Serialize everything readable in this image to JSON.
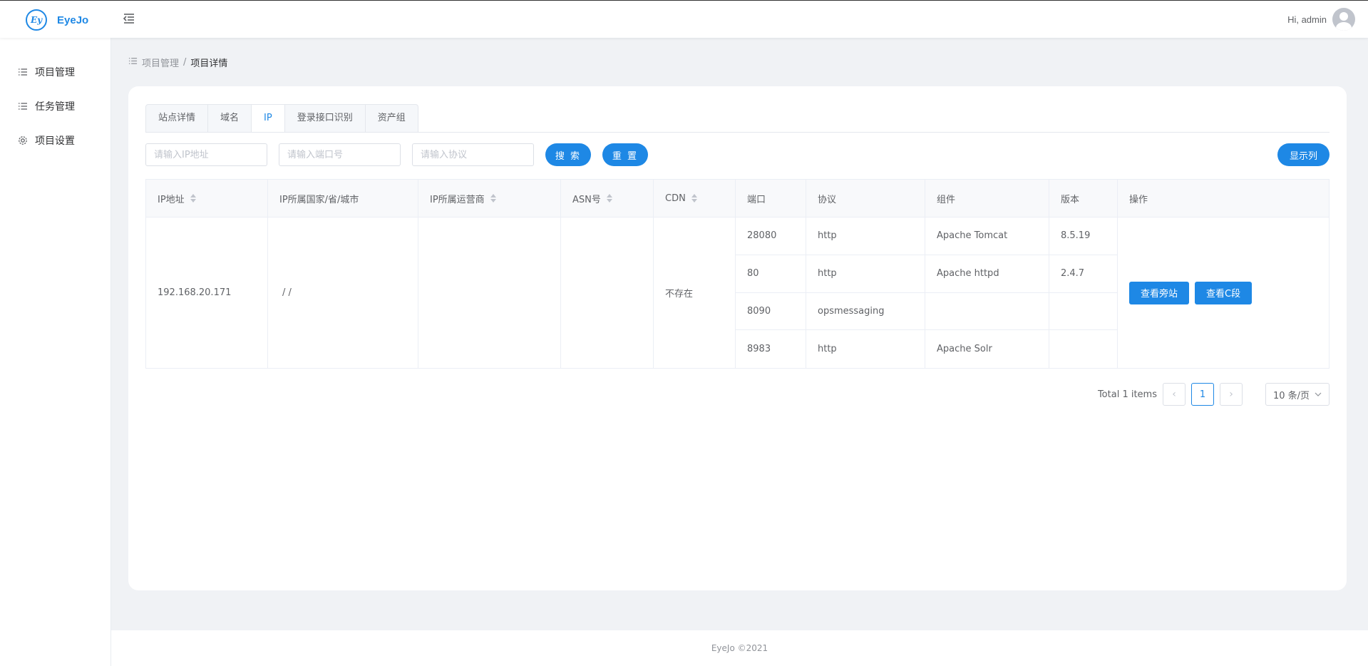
{
  "app": {
    "name": "EyeJo"
  },
  "header": {
    "greeting": "Hi, admin"
  },
  "sidebar": {
    "items": [
      {
        "label": "项目管理",
        "icon": "list-icon"
      },
      {
        "label": "任务管理",
        "icon": "list-icon"
      },
      {
        "label": "项目设置",
        "icon": "gear-icon"
      }
    ]
  },
  "breadcrumb": {
    "parent": "项目管理",
    "separator": "/",
    "current": "项目详情"
  },
  "tabs": [
    "站点详情",
    "域名",
    "IP",
    "登录接口识别",
    "资产组"
  ],
  "active_tab": "IP",
  "search": {
    "ip_placeholder": "请输入IP地址",
    "port_placeholder": "请输入端口号",
    "protocol_placeholder": "请输入协议",
    "search_label": "搜 索",
    "reset_label": "重 置",
    "columns_label": "显示列"
  },
  "table": {
    "headers": [
      "IP地址",
      "IP所属国家/省/城市",
      "IP所属运营商",
      "ASN号",
      "CDN",
      "端口",
      "协议",
      "组件",
      "版本",
      "操作"
    ],
    "row": {
      "ip": "192.168.20.171",
      "location": "/ /",
      "isp": "",
      "asn": "",
      "cdn": "不存在",
      "ports": [
        {
          "port": "28080",
          "protocol": "http",
          "component": "Apache Tomcat",
          "version": "8.5.19"
        },
        {
          "port": "80",
          "protocol": "http",
          "component": "Apache httpd",
          "version": "2.4.7"
        },
        {
          "port": "8090",
          "protocol": "opsmessaging",
          "component": "",
          "version": ""
        },
        {
          "port": "8983",
          "protocol": "http",
          "component": "Apache Solr",
          "version": ""
        }
      ],
      "op_side_site": "查看旁站",
      "op_c_segment": "查看C段"
    }
  },
  "pagination": {
    "total": "Total 1 items",
    "current_page": "1",
    "page_size": "10 条/页"
  },
  "footer": {
    "text": "EyeJo ©2021"
  },
  "colors": {
    "primary": "#1e88e5",
    "background": "#f0f2f5"
  }
}
